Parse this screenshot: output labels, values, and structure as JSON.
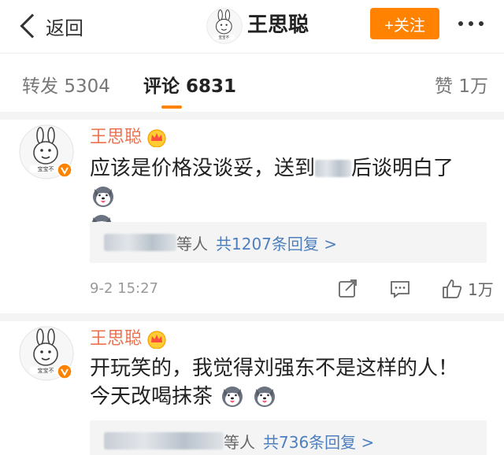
{
  "header": {
    "back_label": "返回",
    "title": "王思聪",
    "follow_label": "+关注"
  },
  "tabs": [
    {
      "label": "转发",
      "count": "5304"
    },
    {
      "label": "评论",
      "count": "6831"
    },
    {
      "label": "赞",
      "count": "1万"
    }
  ],
  "comments": [
    {
      "user": "王思聪",
      "text_before": "应该是价格没谈妥，送到",
      "text_after": "后谈明白了",
      "reply_suffix": "等人",
      "reply_count": "共1207条回复 >",
      "time": "9-2 15:27",
      "likes": "1万"
    },
    {
      "user": "王思聪",
      "text": "开玩笑的，我觉得刘强东不是这样的人！ 今天改喝抹茶",
      "reply_suffix": "等人",
      "reply_count": "共736条回复 >"
    }
  ],
  "colors": {
    "accent": "#ff8200",
    "username": "#eb7350",
    "link": "#4d7fbf"
  },
  "icons": [
    "back-chevron-icon",
    "more-icon",
    "vip-crown-icon",
    "verified-badge-icon",
    "husky-emoji-icon",
    "share-icon",
    "comment-icon",
    "like-icon"
  ]
}
